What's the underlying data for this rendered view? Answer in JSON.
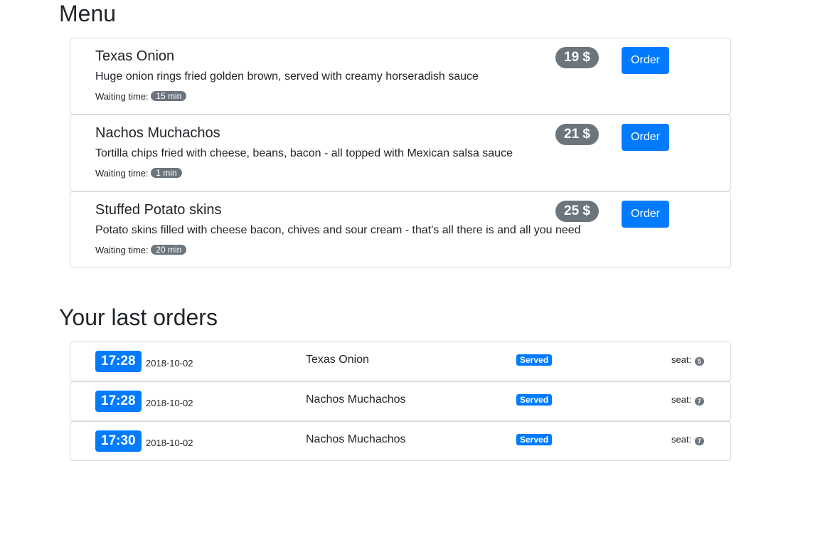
{
  "menu": {
    "title": "Menu",
    "items": [
      {
        "name": "Texas Onion",
        "description": "Huge onion rings fried golden brown, served with creamy horseradish sauce",
        "wait_label": "Waiting time:",
        "wait": "15 min",
        "price": "19 $",
        "order_label": "Order"
      },
      {
        "name": "Nachos Muchachos",
        "description": "Tortilla chips fried with cheese, beans, bacon - all topped with Mexican salsa sauce",
        "wait_label": "Waiting time:",
        "wait": "1 min",
        "price": "21 $",
        "order_label": "Order"
      },
      {
        "name": "Stuffed Potato skins",
        "description": "Potato skins filled with cheese bacon, chives and sour cream - that's all there is and all you need",
        "wait_label": "Waiting time:",
        "wait": "20 min",
        "price": "25 $",
        "order_label": "Order"
      }
    ]
  },
  "orders": {
    "title": "Your last orders",
    "items": [
      {
        "time": "17:28",
        "date": "2018-10-02",
        "name": "Texas Onion",
        "status": "Served",
        "seat_label": "seat:",
        "seat": "5"
      },
      {
        "time": "17:28",
        "date": "2018-10-02",
        "name": "Nachos Muchachos",
        "status": "Served",
        "seat_label": "seat:",
        "seat": "7"
      },
      {
        "time": "17:30",
        "date": "2018-10-02",
        "name": "Nachos Muchachos",
        "status": "Served",
        "seat_label": "seat:",
        "seat": "7"
      }
    ]
  },
  "colors": {
    "primary": "#007bff",
    "secondary": "#6c757d",
    "text": "#212529"
  }
}
